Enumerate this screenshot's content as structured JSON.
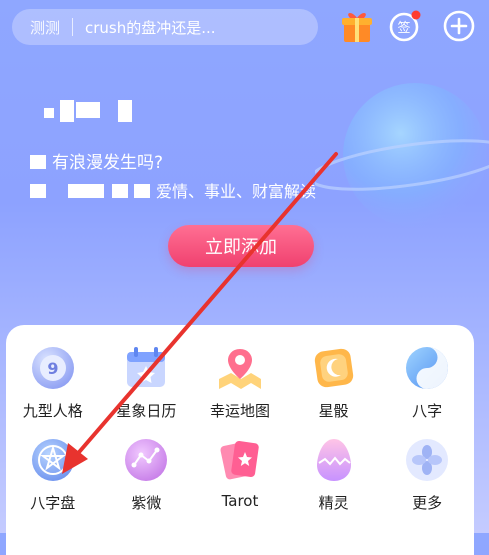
{
  "search": {
    "prefix": "测测",
    "value": "crush的盘冲还是..."
  },
  "banner": {
    "subtitle": "有浪漫发生吗?",
    "desc_suffix": "爱情、事业、财富解读",
    "cta_label": "立即添加"
  },
  "colors": {
    "accent": "#f0416f",
    "background": "#8fa7ff",
    "annotation_arrow": "#e8332e"
  },
  "icons": {
    "gift": "gift-icon",
    "sign": "sign-in-icon",
    "plus": "add-icon"
  },
  "grid": {
    "items": [
      {
        "label": "九型人格",
        "icon": "nine-personality-icon"
      },
      {
        "label": "星象日历",
        "icon": "astro-calendar-icon"
      },
      {
        "label": "幸运地图",
        "icon": "lucky-map-icon"
      },
      {
        "label": "星骰",
        "icon": "star-dice-icon"
      },
      {
        "label": "八字",
        "icon": "bazi-icon"
      },
      {
        "label": "八字盘",
        "icon": "bazi-chart-icon"
      },
      {
        "label": "紫微",
        "icon": "ziwei-icon"
      },
      {
        "label": "Tarot",
        "icon": "tarot-icon"
      },
      {
        "label": "精灵",
        "icon": "spirit-egg-icon"
      },
      {
        "label": "更多",
        "icon": "more-icon"
      }
    ]
  }
}
